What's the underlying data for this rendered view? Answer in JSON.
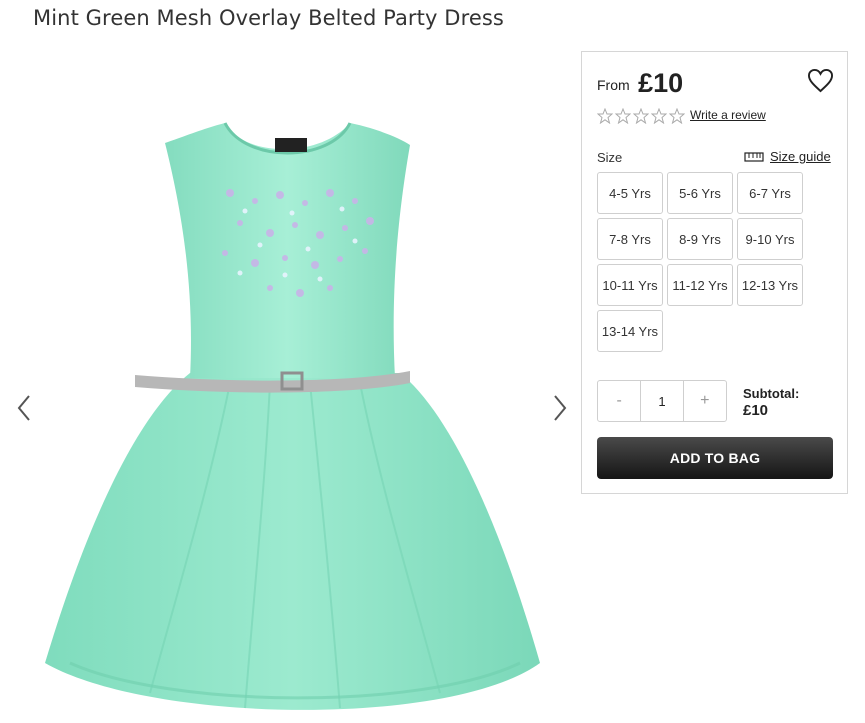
{
  "product": {
    "title": "Mint Green Mesh Overlay Belted Party Dress"
  },
  "gallery": {
    "prev_icon": "chevron-left-icon",
    "next_icon": "chevron-right-icon",
    "dress_color": "#8fe3c7"
  },
  "pricing": {
    "from_label": "From",
    "price": "£10"
  },
  "wishlist": {
    "icon": "heart-outline-icon"
  },
  "rating": {
    "stars": 0,
    "max": 5,
    "review_link": "Write a review"
  },
  "size": {
    "label": "Size",
    "guide_label": "Size guide",
    "options": [
      "4-5 Yrs",
      "5-6 Yrs",
      "6-7 Yrs",
      "7-8 Yrs",
      "8-9 Yrs",
      "9-10 Yrs",
      "10-11 Yrs",
      "11-12 Yrs",
      "12-13 Yrs",
      "13-14 Yrs"
    ]
  },
  "quantity": {
    "minus": "-",
    "value": "1",
    "plus": "+"
  },
  "subtotal": {
    "label": "Subtotal:",
    "value": "£10"
  },
  "cart": {
    "add_label": "ADD TO BAG"
  }
}
